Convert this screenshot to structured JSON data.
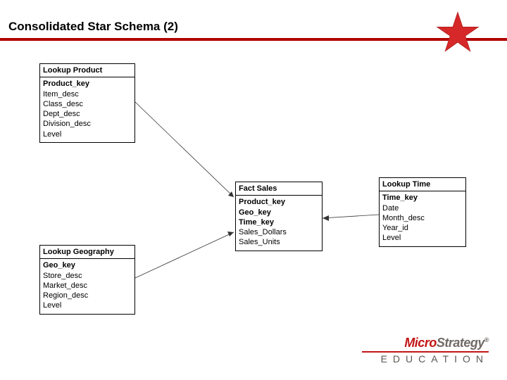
{
  "title": "Consolidated Star Schema (2)",
  "tables": {
    "product": {
      "header": "Lookup Product",
      "fields": [
        "Product_key",
        "Item_desc",
        "Class_desc",
        "Dept_desc",
        "Division_desc",
        "Level"
      ],
      "keys": [
        "Product_key"
      ]
    },
    "fact": {
      "header": "Fact Sales",
      "fields": [
        "Product_key",
        "Geo_key",
        "Time_key",
        "Sales_Dollars",
        "Sales_Units"
      ],
      "keys": [
        "Product_key",
        "Geo_key",
        "Time_key"
      ]
    },
    "time": {
      "header": "Lookup Time",
      "fields": [
        "Time_key",
        "Date",
        "Month_desc",
        "Year_id",
        "Level"
      ],
      "keys": [
        "Time_key"
      ]
    },
    "geography": {
      "header": "Lookup Geography",
      "fields": [
        "Geo_key",
        "Store_desc",
        "Market_desc",
        "Region_desc",
        "Level"
      ],
      "keys": [
        "Geo_key"
      ]
    }
  },
  "brand": {
    "part1": "Micro",
    "part2": "Strategy",
    "trademark": "®",
    "sub": "EDUCATION"
  }
}
